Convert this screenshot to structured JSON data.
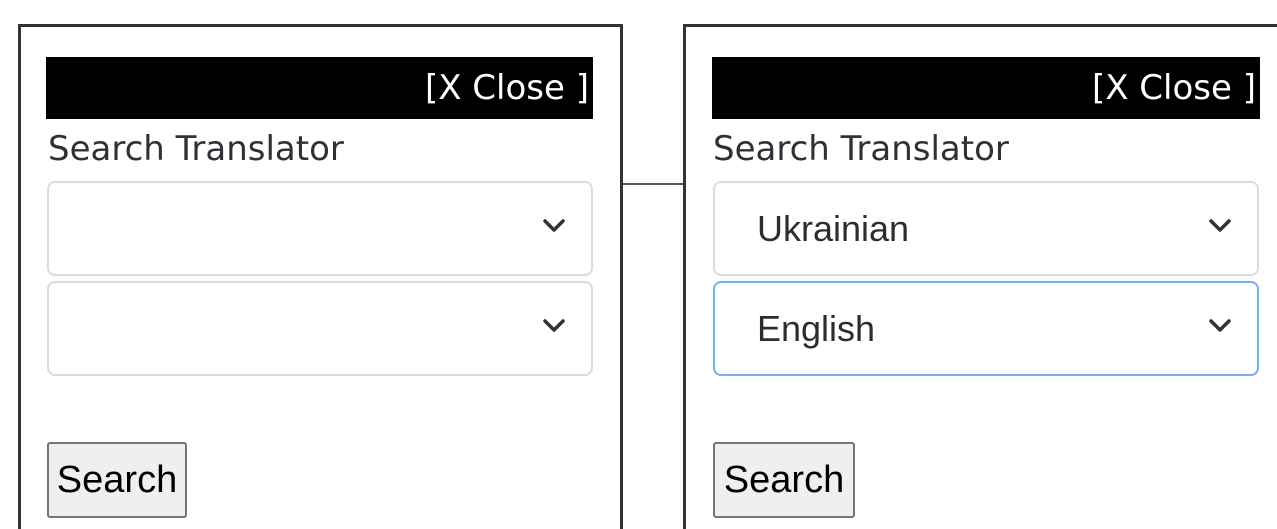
{
  "panels": [
    {
      "close_label": "[X Close ]",
      "title": "Search Translator",
      "source_language": "",
      "target_language": "",
      "search_label": "Search"
    },
    {
      "close_label": "[X Close ]",
      "title": "Search Translator",
      "source_language": "Ukrainian",
      "target_language": "English",
      "search_label": "Search"
    }
  ],
  "colors": {
    "close_bar_bg": "#000000",
    "close_bar_text": "#ffffff",
    "select_focus_border": "#76aef2",
    "select_border": "#dcdcdc",
    "button_bg": "#efefef"
  },
  "icons": [
    "chevron-down-icon"
  ]
}
